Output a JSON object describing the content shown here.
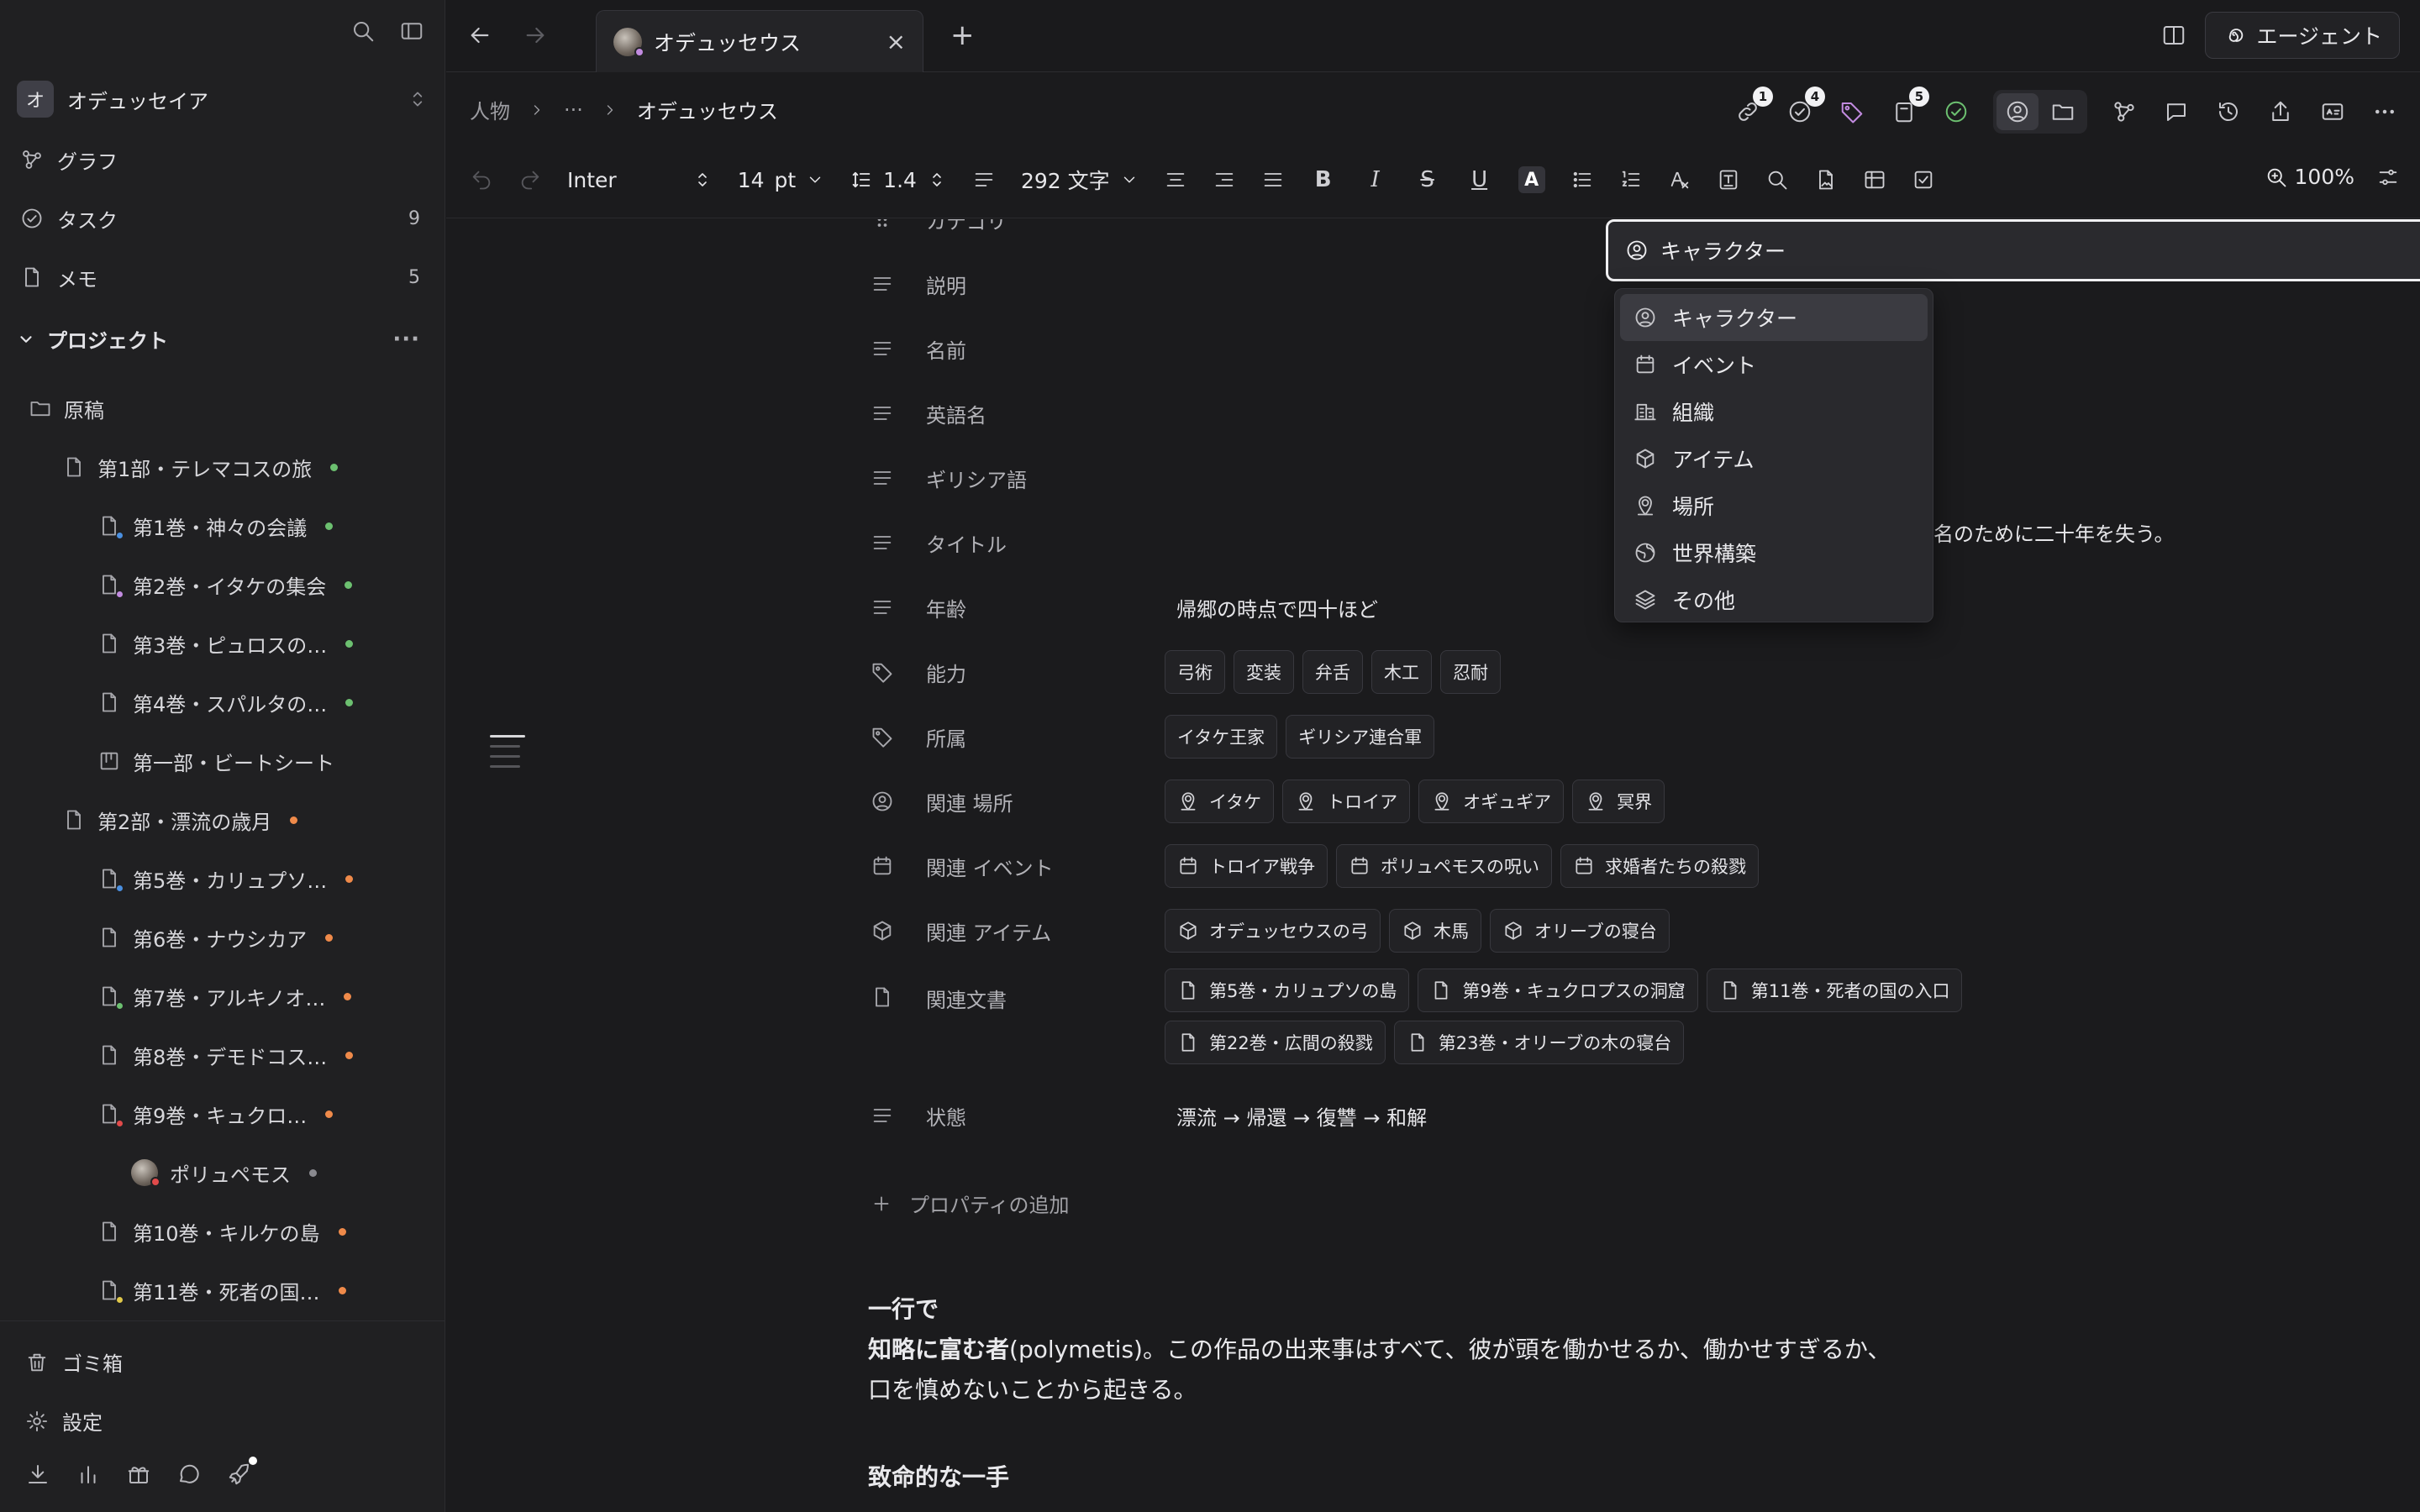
{
  "sidebar": {
    "workspace": {
      "initial": "オ",
      "name": "オデュッセイア"
    },
    "nav": [
      {
        "label": "グラフ",
        "count": ""
      },
      {
        "label": "タスク",
        "count": "9"
      },
      {
        "label": "メモ",
        "count": "5"
      }
    ],
    "section": {
      "label": "プロジェクト",
      "more": "···"
    },
    "tree": [
      {
        "label": "原稿",
        "icon": "folder-icon",
        "level": 0
      },
      {
        "label": "第1部・テレマコスの旅",
        "icon": "document-icon",
        "level": 1,
        "dot": "g"
      },
      {
        "label": "第1巻・神々の会議",
        "icon": "document-icon",
        "level": 2,
        "dot": "g",
        "sub": "#4a8fe0"
      },
      {
        "label": "第2巻・イタケの集会",
        "icon": "document-icon",
        "level": 2,
        "dot": "g",
        "sub": "#c28be0"
      },
      {
        "label": "第3巻・ピュロスの…",
        "icon": "document-icon",
        "level": 2,
        "dot": "g"
      },
      {
        "label": "第4巻・スパルタの…",
        "icon": "document-icon",
        "level": 2,
        "dot": "g"
      },
      {
        "label": "第一部・ビートシート",
        "icon": "board-icon",
        "level": 2
      },
      {
        "label": "第2部・漂流の歳月",
        "icon": "document-icon",
        "level": 1,
        "dot": "o"
      },
      {
        "label": "第5巻・カリュプソ…",
        "icon": "document-icon",
        "level": 2,
        "dot": "o",
        "sub": "#4a8fe0"
      },
      {
        "label": "第6巻・ナウシカア",
        "icon": "document-icon",
        "level": 2,
        "dot": "o"
      },
      {
        "label": "第7巻・アルキノオ…",
        "icon": "document-icon",
        "level": 2,
        "dot": "o",
        "sub": "#6cc070"
      },
      {
        "label": "第8巻・デモドコス…",
        "icon": "document-icon",
        "level": 2,
        "dot": "o"
      },
      {
        "label": "第9巻・キュクロ…",
        "icon": "document-icon",
        "level": 2,
        "dot": "o",
        "sub": "#e04a4a"
      },
      {
        "label": "ポリュペモス",
        "icon": "avatar-icon",
        "level": 3,
        "dot": "gr"
      },
      {
        "label": "第10巻・キルケの島",
        "icon": "document-icon",
        "level": 2,
        "dot": "o"
      },
      {
        "label": "第11巻・死者の国…",
        "icon": "document-icon",
        "level": 2,
        "dot": "o",
        "sub": "#e0c84a"
      }
    ],
    "trash": "ゴミ箱",
    "settings": "設定"
  },
  "topbar": {
    "tab_title": "オデュッセウス",
    "tab_close": "×",
    "new_tab": "+",
    "agent_label": "エージェント"
  },
  "breadcrumb": {
    "root": "人物",
    "ellipsis": "···",
    "current": "オデュッセウス",
    "badges": {
      "links": "1",
      "tasks": "4",
      "docs": "5"
    }
  },
  "format": {
    "font": "Inter",
    "size": "14",
    "size_unit": "pt",
    "line_height": "1.4",
    "word_count": "292 文字",
    "bold": "B",
    "italic": "I",
    "strike": "S",
    "underline": "U",
    "text_color": "A",
    "zoom": "100%"
  },
  "properties": {
    "category": {
      "label": "カテゴリ",
      "value": "キャラクター"
    },
    "description": {
      "label": "説明",
      "value_tail": "名のために二十年を失う。"
    },
    "name": {
      "label": "名前"
    },
    "english_name": {
      "label": "英語名"
    },
    "greek": {
      "label": "ギリシア語"
    },
    "title": {
      "label": "タイトル"
    },
    "age": {
      "label": "年齢",
      "value": "帰郷の時点で四十ほど"
    },
    "abilities": {
      "label": "能力",
      "values": [
        "弓術",
        "変装",
        "弁舌",
        "木工",
        "忍耐"
      ]
    },
    "affiliation": {
      "label": "所属",
      "values": [
        "イタケ王家",
        "ギリシア連合軍"
      ]
    },
    "places": {
      "label": "関連 場所",
      "values": [
        "イタケ",
        "トロイア",
        "オギュギア",
        "冥界"
      ]
    },
    "events": {
      "label": "関連 イベント",
      "values": [
        "トロイア戦争",
        "ポリュペモスの呪い",
        "求婚者たちの殺戮"
      ]
    },
    "items": {
      "label": "関連 アイテム",
      "values": [
        "オデュッセウスの弓",
        "木馬",
        "オリーブの寝台"
      ]
    },
    "documents": {
      "label": "関連文書",
      "values": [
        "第5巻・カリュプソの島",
        "第9巻・キュクロプスの洞窟",
        "第11巻・死者の国の入口",
        "第22巻・広間の殺戮",
        "第23巻・オリーブの木の寝台"
      ]
    },
    "status": {
      "label": "状態",
      "value": "漂流 → 帰還 → 復讐 → 和解"
    },
    "add": "プロパティの追加"
  },
  "dropdown": {
    "options": [
      {
        "label": "キャラクター",
        "icon": "person-icon",
        "selected": true
      },
      {
        "label": "イベント",
        "icon": "calendar-icon"
      },
      {
        "label": "組織",
        "icon": "building-icon"
      },
      {
        "label": "アイテム",
        "icon": "cube-icon"
      },
      {
        "label": "場所",
        "icon": "location-icon"
      },
      {
        "label": "世界構築",
        "icon": "globe-icon"
      },
      {
        "label": "その他",
        "icon": "layers-icon"
      }
    ]
  },
  "body": {
    "heading1": "一行で",
    "para_bold": "知略に富む者",
    "para_rest_line1": "(polymetis)。この作品の出来事はすべて、彼が頭を働かせるか、働かせすぎるか、",
    "para_line2": "口を慎めないことから起きる。",
    "heading2": "致命的な一手"
  }
}
